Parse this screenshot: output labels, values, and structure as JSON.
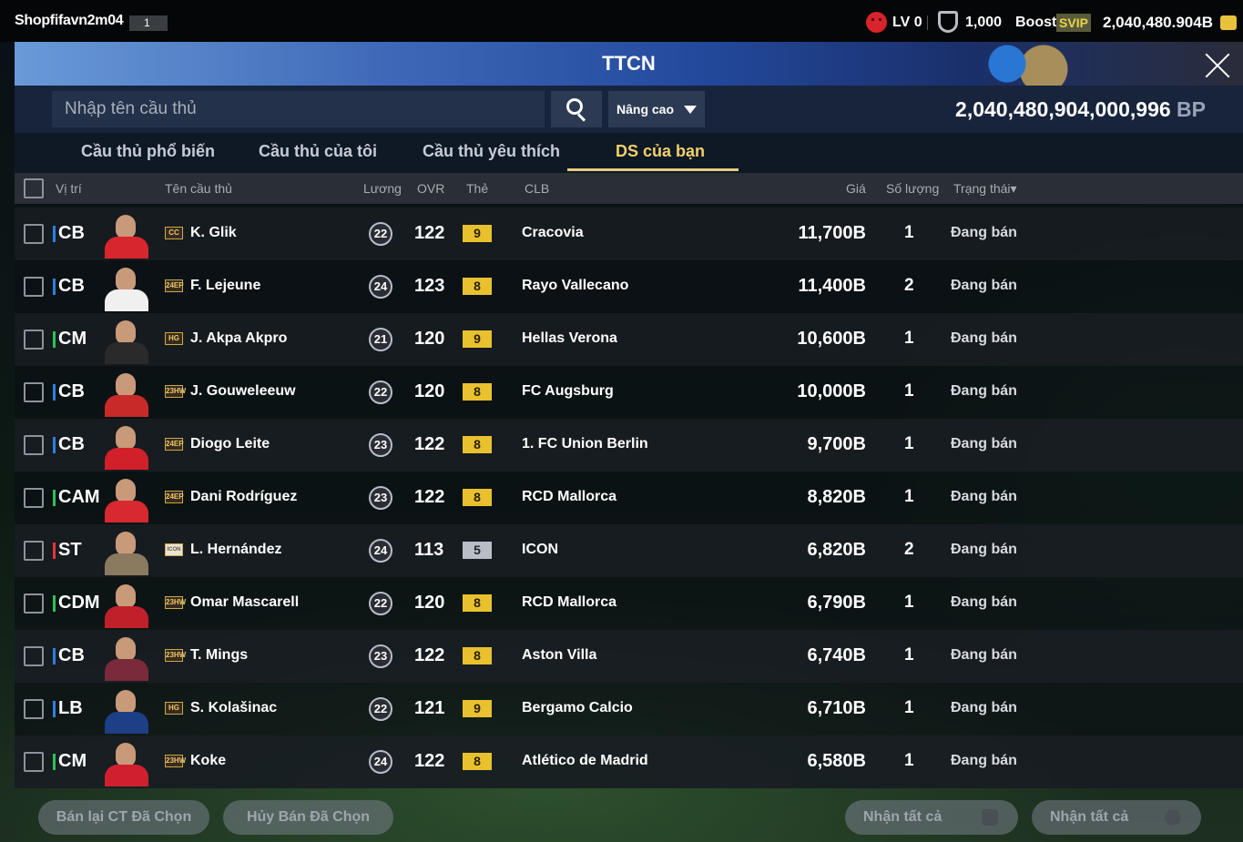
{
  "topbar": {
    "username": "Shopfifavn2m04",
    "user_num": "1",
    "level": "LV 0",
    "coins": "1,000",
    "boost_label": "Boost",
    "svip_label": "SVIP",
    "bp_total": "2,040,480.904B"
  },
  "title": "TTCN",
  "search": {
    "placeholder": "Nhập tên cầu thủ",
    "advanced_label": "Nâng cao"
  },
  "balance": {
    "value": "2,040,480,904,000,996",
    "unit": "BP"
  },
  "tabs": [
    {
      "label": "Cầu thủ phổ biến"
    },
    {
      "label": "Cầu thủ của tôi"
    },
    {
      "label": "Cầu thủ yêu thích"
    },
    {
      "label": "DS của bạn"
    }
  ],
  "columns": {
    "position": "Vị trí",
    "name": "Tên cầu thủ",
    "wage": "Lương",
    "ovr": "OVR",
    "grade": "Thẻ",
    "club": "CLB",
    "price": "Giá",
    "qty": "Số lượng",
    "status": "Trạng thái"
  },
  "colors": {
    "defender": "#2f7fe0",
    "midfielder": "#2fc15a",
    "attacker": "#e3343e",
    "grade_gold": "#e9c12e",
    "active_tab": "#f2d06b"
  },
  "rows": [
    {
      "pos": "CB",
      "season": "CC",
      "name": "K. Glik",
      "wage": "22",
      "ovr": "122",
      "grade": "9",
      "club": "Cracovia",
      "price": "11,700B",
      "qty": "1",
      "status": "Đang bán"
    },
    {
      "pos": "CB",
      "season": "24EP",
      "name": "F. Lejeune",
      "wage": "24",
      "ovr": "123",
      "grade": "8",
      "club": "Rayo Vallecano",
      "price": "11,400B",
      "qty": "2",
      "status": "Đang bán"
    },
    {
      "pos": "CM",
      "season": "HG",
      "name": "J. Akpa Akpro",
      "wage": "21",
      "ovr": "120",
      "grade": "9",
      "club": "Hellas Verona",
      "price": "10,600B",
      "qty": "1",
      "status": "Đang bán"
    },
    {
      "pos": "CB",
      "season": "23HW",
      "name": "J. Gouweleeuw",
      "wage": "22",
      "ovr": "120",
      "grade": "8",
      "club": "FC Augsburg",
      "price": "10,000B",
      "qty": "1",
      "status": "Đang bán"
    },
    {
      "pos": "CB",
      "season": "24EP",
      "name": "Diogo Leite",
      "wage": "23",
      "ovr": "122",
      "grade": "8",
      "club": "1. FC Union Berlin",
      "price": "9,700B",
      "qty": "1",
      "status": "Đang bán"
    },
    {
      "pos": "CAM",
      "season": "24EP",
      "name": "Dani Rodríguez",
      "wage": "23",
      "ovr": "122",
      "grade": "8",
      "club": "RCD Mallorca",
      "price": "8,820B",
      "qty": "1",
      "status": "Đang bán"
    },
    {
      "pos": "ST",
      "season": "ICON",
      "name": "L. Hernández",
      "wage": "24",
      "ovr": "113",
      "grade": "5",
      "club": "ICON",
      "price": "6,820B",
      "qty": "2",
      "status": "Đang bán"
    },
    {
      "pos": "CDM",
      "season": "23HW",
      "name": "Omar Mascarell",
      "wage": "22",
      "ovr": "120",
      "grade": "8",
      "club": "RCD Mallorca",
      "price": "6,790B",
      "qty": "1",
      "status": "Đang bán"
    },
    {
      "pos": "CB",
      "season": "23HW",
      "name": "T. Mings",
      "wage": "23",
      "ovr": "122",
      "grade": "8",
      "club": "Aston Villa",
      "price": "6,740B",
      "qty": "1",
      "status": "Đang bán"
    },
    {
      "pos": "LB",
      "season": "HG",
      "name": "S. Kolašinac",
      "wage": "22",
      "ovr": "121",
      "grade": "9",
      "club": "Bergamo Calcio",
      "price": "6,710B",
      "qty": "1",
      "status": "Đang bán"
    },
    {
      "pos": "CM",
      "season": "23HW",
      "name": "Koke",
      "wage": "24",
      "ovr": "122",
      "grade": "8",
      "club": "Atlético de Madrid",
      "price": "6,580B",
      "qty": "1",
      "status": "Đang bán"
    }
  ],
  "bottom_buttons": {
    "resell_selected": "Bán lại CT Đã Chọn",
    "cancel_selected": "Hủy Bán Đã Chọn",
    "receive_all_players": "Nhận tất cả",
    "receive_all_bp": "Nhận tất cả"
  }
}
